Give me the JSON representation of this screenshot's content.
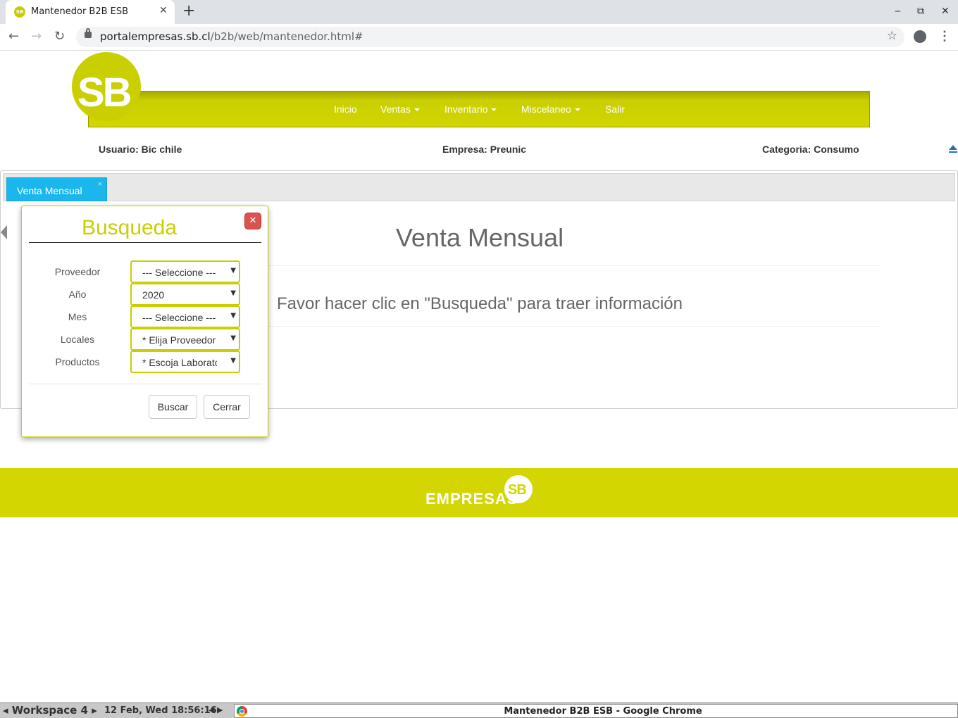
{
  "browser": {
    "tab_title": "Mantenedor B2B ESB",
    "tab_favicon_text": "SB",
    "url_host": "portalempresas.sb.cl",
    "url_path": "/b2b/web/mantenedor.html#"
  },
  "header": {
    "logo_text": "SB",
    "nav": [
      {
        "label": "Inicio",
        "dropdown": false
      },
      {
        "label": "Ventas",
        "dropdown": true
      },
      {
        "label": "Inventario",
        "dropdown": true
      },
      {
        "label": "Miscelaneo",
        "dropdown": true
      },
      {
        "label": "Salir",
        "dropdown": false
      }
    ]
  },
  "user_info": {
    "usuario": "Usuario: Bic chile",
    "empresa": "Empresa: Preunic",
    "categoria": "Categoria: Consumo"
  },
  "main": {
    "tab_label": "Venta Mensual",
    "tab_close": "×",
    "title": "Venta Mensual",
    "message": "Favor hacer clic en \"Busqueda\" para traer información"
  },
  "dialog": {
    "title": "Busqueda",
    "fields": [
      {
        "label": "Proveedor",
        "value": "--- Seleccione ---"
      },
      {
        "label": "Año",
        "value": "2020"
      },
      {
        "label": "Mes",
        "value": "--- Seleccione ---"
      },
      {
        "label": "Locales",
        "value": "* Elija Proveedor *"
      },
      {
        "label": "Productos",
        "value": "* Escoja Laboratorio *"
      }
    ],
    "buscar_label": "Buscar",
    "cerrar_label": "Cerrar"
  },
  "footer": {
    "logo_text": "EMPRESAS",
    "logo_badge": "SB"
  },
  "taskbar": {
    "workspace": "Workspace 4",
    "clock": "12 Feb, Wed 18:56:16",
    "window_title": "Mantenedor B2B ESB - Google Chrome"
  },
  "colors": {
    "brand": "#c9cf00",
    "tab_active": "#1ab6ee",
    "close_button": "#d9534f"
  }
}
